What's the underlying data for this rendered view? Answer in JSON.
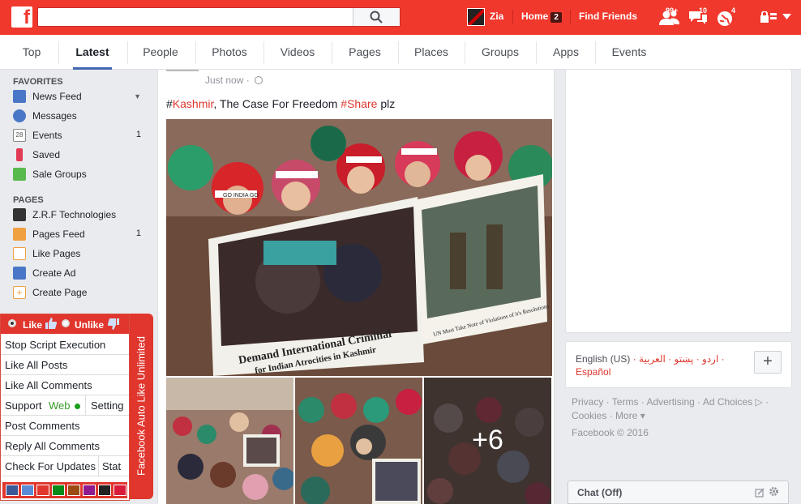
{
  "topbar": {
    "logo": "f",
    "search_placeholder": "",
    "user_name": "Zia",
    "home_label": "Home",
    "home_count": "2",
    "find_friends": "Find Friends",
    "friend_requests_count": "99+",
    "messages_count": "10",
    "notifications_count": "4"
  },
  "tabs": [
    {
      "label": "Top"
    },
    {
      "label": "Latest"
    },
    {
      "label": "People"
    },
    {
      "label": "Photos"
    },
    {
      "label": "Videos"
    },
    {
      "label": "Pages"
    },
    {
      "label": "Places"
    },
    {
      "label": "Groups"
    },
    {
      "label": "Apps"
    },
    {
      "label": "Events"
    }
  ],
  "sidebar": {
    "favorites_heading": "FAVORITES",
    "favorites": [
      {
        "label": "News Feed",
        "icon": "news-feed-icon",
        "color": "#4a76c8"
      },
      {
        "label": "Messages",
        "icon": "messages-icon",
        "color": "#4a76c8"
      },
      {
        "label": "Events",
        "icon": "calendar-icon",
        "color": "#888888",
        "count": "1"
      },
      {
        "label": "Saved",
        "icon": "bookmark-icon",
        "color": "#e23a52"
      },
      {
        "label": "Sale Groups",
        "icon": "sale-tag-icon",
        "color": "#58b94c"
      }
    ],
    "pages_heading": "PAGES",
    "pages": [
      {
        "label": "Z.R.F Technologies",
        "icon": "page-logo-icon",
        "color": "#333333"
      },
      {
        "label": "Pages Feed",
        "icon": "pages-feed-icon",
        "color": "#f0a040",
        "count": "1"
      },
      {
        "label": "Like Pages",
        "icon": "like-pages-icon",
        "color": "#f0a040"
      },
      {
        "label": "Create Ad",
        "icon": "chart-icon",
        "color": "#4a76c8"
      },
      {
        "label": "Create Page",
        "icon": "plus-icon",
        "color": "#f0a040"
      }
    ]
  },
  "story": {
    "time": "Just now",
    "text_before": "#",
    "hashtag1": "Kashmir",
    "text_middle": ", The Case For Freedom ",
    "hash2": "#",
    "hashtag2": "Share",
    "text_after": " plz",
    "sign_left": "Demand International Criminal",
    "sign_left2": "for Indian Atrocities in Kashmir",
    "sign_right": "UN Must Take Note of Violations of it's Resolutions",
    "headband": "GO INDIA GO",
    "more_photos": "+6"
  },
  "right": {
    "lang_current": "English (US)",
    "lang_others": " · اردو · پښتو · العربية ·",
    "lang_red": "Español",
    "plus": "+",
    "footer_line1": "Privacy · Terms · Advertising · Ad Choices ▷ ·",
    "footer_line2": "Cookies · More ▾",
    "copyright": "Facebook © 2016",
    "chat": "Chat (Off)"
  },
  "panel": {
    "like": "Like",
    "unlike": "Unlike",
    "stop": "Stop Script Execution",
    "like_posts": "Like All Posts",
    "like_comments": "Like All Comments",
    "support": "Support",
    "web": "Web",
    "setting": "Setting",
    "post_comments": "Post Comments",
    "reply_comments": "Reply All Comments",
    "check_updates": "Check For Updates",
    "stat": "Stat",
    "side_title": "Facebook Auto Like Unlimited",
    "swatches": [
      "#3b5998",
      "#5b8bd6",
      "#e0362d",
      "#0a8a1a",
      "#9b4a12",
      "#8e1a8e",
      "#222222",
      "#d81b3a"
    ]
  },
  "colors": {
    "brand": "#f0382d",
    "link": "#e0362d",
    "accent": "#4267b2"
  }
}
